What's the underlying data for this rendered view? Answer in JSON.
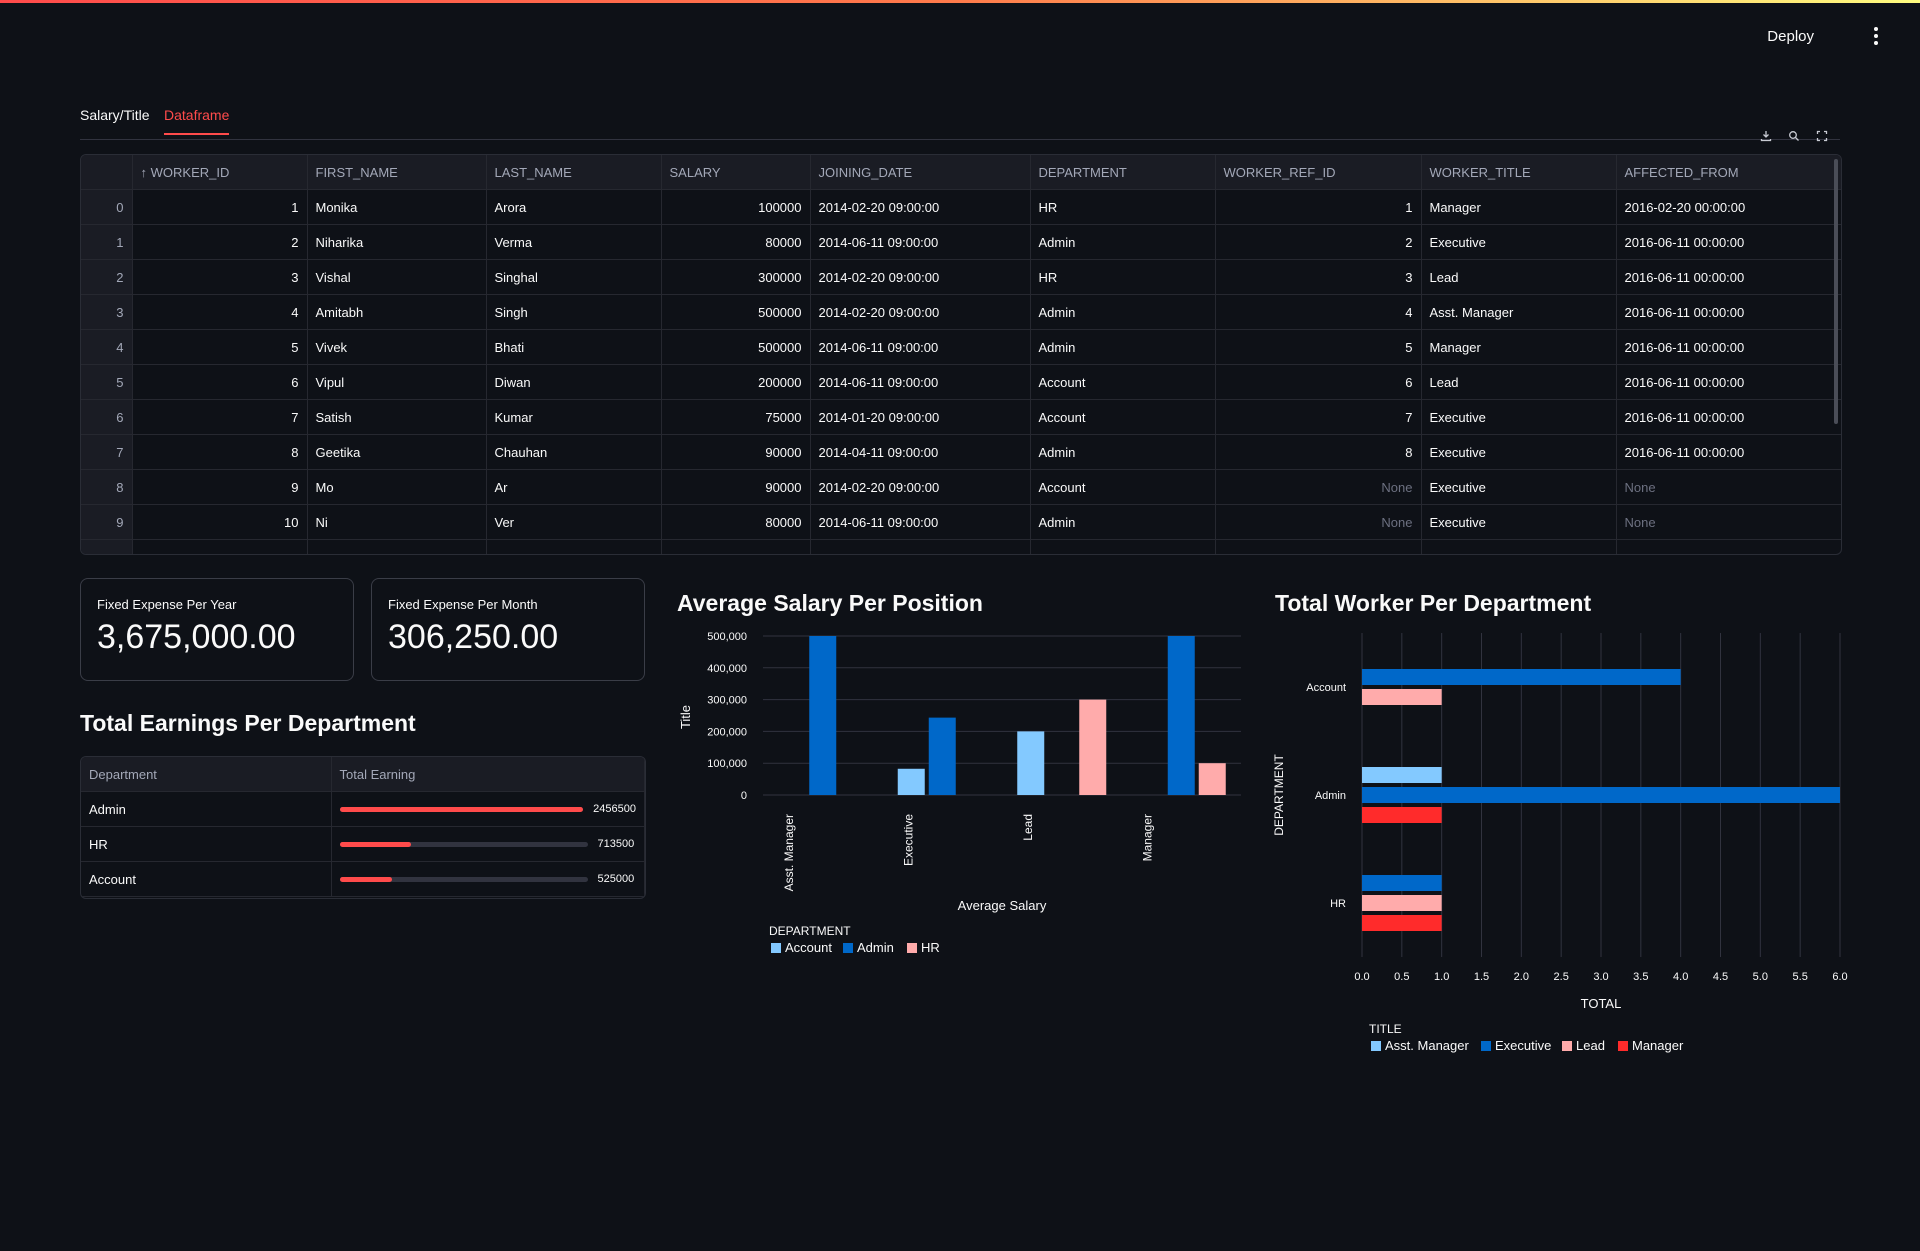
{
  "header": {
    "deploy_label": "Deploy"
  },
  "tabs": [
    {
      "label": "Salary/Title",
      "active": false
    },
    {
      "label": "Dataframe",
      "active": true
    }
  ],
  "toolbar_icons": [
    "download-icon",
    "search-icon",
    "fullscreen-icon"
  ],
  "dataframe": {
    "sort_arrow": "↑",
    "columns": [
      "WORKER_ID",
      "FIRST_NAME",
      "LAST_NAME",
      "SALARY",
      "JOINING_DATE",
      "DEPARTMENT",
      "WORKER_REF_ID",
      "WORKER_TITLE",
      "AFFECTED_FROM"
    ],
    "rows": [
      [
        "0",
        "1",
        "Monika",
        "Arora",
        "100000",
        "2014-02-20 09:00:00",
        "HR",
        "1",
        "Manager",
        "2016-02-20 00:00:00"
      ],
      [
        "1",
        "2",
        "Niharika",
        "Verma",
        "80000",
        "2014-06-11 09:00:00",
        "Admin",
        "2",
        "Executive",
        "2016-06-11 00:00:00"
      ],
      [
        "2",
        "3",
        "Vishal",
        "Singhal",
        "300000",
        "2014-02-20 09:00:00",
        "HR",
        "3",
        "Lead",
        "2016-06-11 00:00:00"
      ],
      [
        "3",
        "4",
        "Amitabh",
        "Singh",
        "500000",
        "2014-02-20 09:00:00",
        "Admin",
        "4",
        "Asst. Manager",
        "2016-06-11 00:00:00"
      ],
      [
        "4",
        "5",
        "Vivek",
        "Bhati",
        "500000",
        "2014-06-11 09:00:00",
        "Admin",
        "5",
        "Manager",
        "2016-06-11 00:00:00"
      ],
      [
        "5",
        "6",
        "Vipul",
        "Diwan",
        "200000",
        "2014-06-11 09:00:00",
        "Account",
        "6",
        "Lead",
        "2016-06-11 00:00:00"
      ],
      [
        "6",
        "7",
        "Satish",
        "Kumar",
        "75000",
        "2014-01-20 09:00:00",
        "Account",
        "7",
        "Executive",
        "2016-06-11 00:00:00"
      ],
      [
        "7",
        "8",
        "Geetika",
        "Chauhan",
        "90000",
        "2014-04-11 09:00:00",
        "Admin",
        "8",
        "Executive",
        "2016-06-11 00:00:00"
      ],
      [
        "8",
        "9",
        "Mo",
        "Ar",
        "90000",
        "2014-02-20 09:00:00",
        "Account",
        "None",
        "Executive",
        "None"
      ],
      [
        "9",
        "10",
        "Ni",
        "Ver",
        "80000",
        "2014-06-11 09:00:00",
        "Admin",
        "None",
        "Executive",
        "None"
      ]
    ]
  },
  "metrics": {
    "year": {
      "label": "Fixed Expense Per Year",
      "value": "3,675,000.00"
    },
    "month": {
      "label": "Fixed Expense Per Month",
      "value": "306,250.00"
    }
  },
  "earnings": {
    "title": "Total Earnings Per Department",
    "col_department": "Department",
    "col_total": "Total Earning",
    "rows": [
      {
        "department": "Admin",
        "value": "2456500",
        "fraction": 1.0
      },
      {
        "department": "HR",
        "value": "713500",
        "fraction": 0.29
      },
      {
        "department": "Account",
        "value": "525000",
        "fraction": 0.21
      }
    ]
  },
  "colors": {
    "accent": "#ff4b4b",
    "background": "#0e1117",
    "account": "#83c9ff",
    "admin": "#0068c9",
    "hr": "#ffabab",
    "manager": "#ff2b2b"
  },
  "chart_data": [
    {
      "type": "bar",
      "title": "Average Salary Per Position",
      "xlabel": "Average Salary",
      "ylabel": "Title",
      "categories": [
        "Asst. Manager",
        "Executive",
        "Lead",
        "Manager"
      ],
      "ylim": [
        0,
        500000
      ],
      "yticks": [
        "0",
        "100,000",
        "200,000",
        "300,000",
        "400,000",
        "500,000"
      ],
      "legend_title": "DEPARTMENT",
      "legend_position": "bottom-left",
      "series": [
        {
          "name": "Account",
          "color": "#83c9ff",
          "values": [
            null,
            82500,
            200000,
            null
          ]
        },
        {
          "name": "Admin",
          "color": "#0068c9",
          "values": [
            500000,
            243333,
            null,
            500000
          ]
        },
        {
          "name": "HR",
          "color": "#ffabab",
          "values": [
            null,
            null,
            300000,
            100000
          ]
        }
      ]
    },
    {
      "type": "bar",
      "orientation": "horizontal",
      "title": "Total Worker Per Department",
      "xlabel": "TOTAL",
      "ylabel": "DEPARTMENT",
      "categories": [
        "Account",
        "Admin",
        "HR"
      ],
      "xlim": [
        0,
        6
      ],
      "xticks": [
        "0.0",
        "0.5",
        "1.0",
        "1.5",
        "2.0",
        "2.5",
        "3.0",
        "3.5",
        "4.0",
        "4.5",
        "5.0",
        "5.5",
        "6.0"
      ],
      "legend_title": "TITLE",
      "legend_position": "bottom-left",
      "series": [
        {
          "name": "Asst. Manager",
          "color": "#83c9ff",
          "values": [
            null,
            1,
            null
          ]
        },
        {
          "name": "Executive",
          "color": "#0068c9",
          "values": [
            4,
            6,
            1
          ]
        },
        {
          "name": "Lead",
          "color": "#ffabab",
          "values": [
            1,
            null,
            1
          ]
        },
        {
          "name": "Manager",
          "color": "#ff2b2b",
          "values": [
            null,
            1,
            1
          ]
        }
      ]
    }
  ]
}
